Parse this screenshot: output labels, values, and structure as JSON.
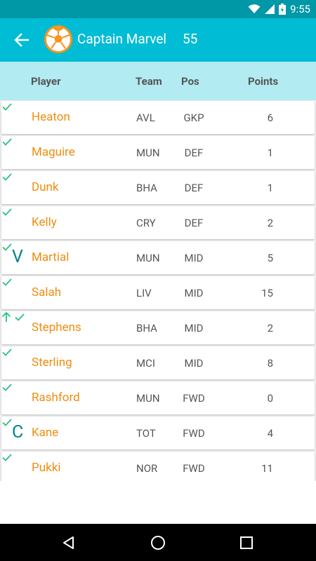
{
  "status_bar": {
    "time": "9:55"
  },
  "toolbar": {
    "team_name": "Captain Marvel",
    "team_points": "55"
  },
  "header": {
    "player": "Player",
    "team": "Team",
    "pos": "Pos",
    "points": "Points"
  },
  "players": [
    {
      "marker": "",
      "name": "Heaton",
      "team": "AVL",
      "pos": "GKP",
      "points": "6",
      "up": false
    },
    {
      "marker": "",
      "name": "Maguire",
      "team": "MUN",
      "pos": "DEF",
      "points": "1",
      "up": false
    },
    {
      "marker": "",
      "name": "Dunk",
      "team": "BHA",
      "pos": "DEF",
      "points": "1",
      "up": false
    },
    {
      "marker": "",
      "name": "Kelly",
      "team": "CRY",
      "pos": "DEF",
      "points": "2",
      "up": false
    },
    {
      "marker": "V",
      "name": "Martial",
      "team": "MUN",
      "pos": "MID",
      "points": "5",
      "up": false
    },
    {
      "marker": "",
      "name": "Salah",
      "team": "LIV",
      "pos": "MID",
      "points": "15",
      "up": false
    },
    {
      "marker": "",
      "name": "Stephens",
      "team": "BHA",
      "pos": "MID",
      "points": "2",
      "up": true
    },
    {
      "marker": "",
      "name": "Sterling",
      "team": "MCI",
      "pos": "MID",
      "points": "8",
      "up": false
    },
    {
      "marker": "",
      "name": "Rashford",
      "team": "MUN",
      "pos": "FWD",
      "points": "0",
      "up": false
    },
    {
      "marker": "C",
      "name": "Kane",
      "team": "TOT",
      "pos": "FWD",
      "points": "4",
      "up": false
    },
    {
      "marker": "",
      "name": "Pukki",
      "team": "NOR",
      "pos": "FWD",
      "points": "11",
      "up": false
    }
  ],
  "colors": {
    "status_bar": "#0097a7",
    "toolbar": "#00bcd4",
    "header_bg": "#b2ebf2",
    "player_name": "#ef8d10",
    "check": "#26c281",
    "marker": "#00838f"
  },
  "icons": {
    "back": "arrow-left-icon",
    "team_logo": "soccer-ball-icon",
    "status": [
      "wifi-icon",
      "signal-icon",
      "battery-icon"
    ],
    "row_status": "check-icon",
    "transfer": "arrow-up-icon",
    "nav": [
      "back-triangle-icon",
      "home-circle-icon",
      "recents-square-icon"
    ]
  }
}
